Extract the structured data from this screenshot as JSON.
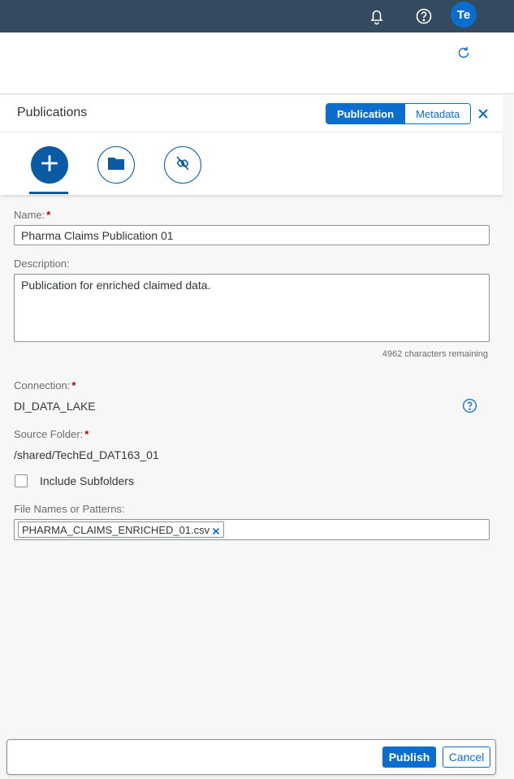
{
  "shellbar": {
    "icons": [
      "bell-icon",
      "help-icon"
    ],
    "avatar_initials": "Te",
    "background": "#354a5f"
  },
  "subheader": {
    "icons": [
      "refresh-icon"
    ]
  },
  "panel": {
    "title": "Publications",
    "segments": [
      {
        "label": "Publication",
        "selected": true
      },
      {
        "label": "Metadata",
        "selected": false
      }
    ]
  },
  "icon_tabs": [
    {
      "icon": "add-icon",
      "selected": true
    },
    {
      "icon": "folder-icon",
      "selected": false
    },
    {
      "icon": "disconnect-icon",
      "selected": false
    }
  ],
  "form": {
    "name": {
      "label": "Name:",
      "required_mark": "*",
      "value": "Pharma Claims Publication 01"
    },
    "description": {
      "label": "Description:",
      "value": "Publication for enriched claimed data.",
      "counter": "4962 characters remaining"
    },
    "connection": {
      "label": "Connection:",
      "required_mark": "*",
      "value": "DI_DATA_LAKE"
    },
    "source_folder": {
      "label": "Source Folder:",
      "required_mark": "*",
      "value": "/shared/TechEd_DAT163_01"
    },
    "include_subfolders": {
      "label": "Include Subfolders",
      "checked": false
    },
    "file_patterns": {
      "label": "File Names or Patterns:",
      "tokens": [
        "PHARMA_CLAIMS_ENRICHED_01.csv"
      ]
    }
  },
  "footer": {
    "publish_label": "Publish",
    "cancel_label": "Cancel"
  },
  "colors": {
    "accent": "#0a6ed1",
    "required": "#bb0000",
    "shell": "#354a5f"
  }
}
